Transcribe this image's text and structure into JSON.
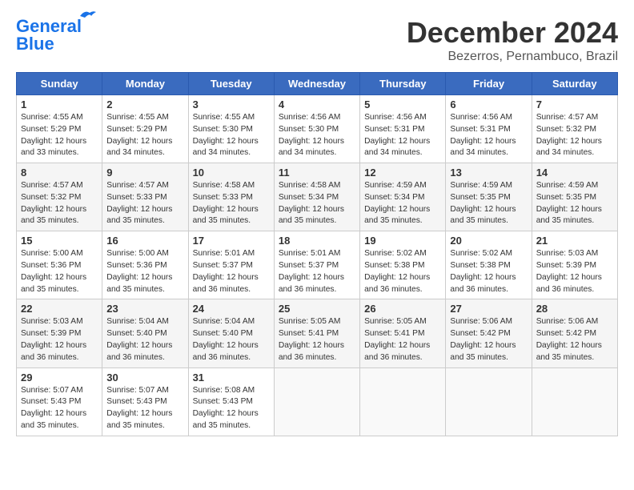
{
  "header": {
    "logo_line1": "General",
    "logo_line2": "Blue",
    "month": "December 2024",
    "location": "Bezerros, Pernambuco, Brazil"
  },
  "weekdays": [
    "Sunday",
    "Monday",
    "Tuesday",
    "Wednesday",
    "Thursday",
    "Friday",
    "Saturday"
  ],
  "weeks": [
    [
      {
        "day": "1",
        "info": "Sunrise: 4:55 AM\nSunset: 5:29 PM\nDaylight: 12 hours\nand 33 minutes."
      },
      {
        "day": "2",
        "info": "Sunrise: 4:55 AM\nSunset: 5:29 PM\nDaylight: 12 hours\nand 34 minutes."
      },
      {
        "day": "3",
        "info": "Sunrise: 4:55 AM\nSunset: 5:30 PM\nDaylight: 12 hours\nand 34 minutes."
      },
      {
        "day": "4",
        "info": "Sunrise: 4:56 AM\nSunset: 5:30 PM\nDaylight: 12 hours\nand 34 minutes."
      },
      {
        "day": "5",
        "info": "Sunrise: 4:56 AM\nSunset: 5:31 PM\nDaylight: 12 hours\nand 34 minutes."
      },
      {
        "day": "6",
        "info": "Sunrise: 4:56 AM\nSunset: 5:31 PM\nDaylight: 12 hours\nand 34 minutes."
      },
      {
        "day": "7",
        "info": "Sunrise: 4:57 AM\nSunset: 5:32 PM\nDaylight: 12 hours\nand 34 minutes."
      }
    ],
    [
      {
        "day": "8",
        "info": "Sunrise: 4:57 AM\nSunset: 5:32 PM\nDaylight: 12 hours\nand 35 minutes."
      },
      {
        "day": "9",
        "info": "Sunrise: 4:57 AM\nSunset: 5:33 PM\nDaylight: 12 hours\nand 35 minutes."
      },
      {
        "day": "10",
        "info": "Sunrise: 4:58 AM\nSunset: 5:33 PM\nDaylight: 12 hours\nand 35 minutes."
      },
      {
        "day": "11",
        "info": "Sunrise: 4:58 AM\nSunset: 5:34 PM\nDaylight: 12 hours\nand 35 minutes."
      },
      {
        "day": "12",
        "info": "Sunrise: 4:59 AM\nSunset: 5:34 PM\nDaylight: 12 hours\nand 35 minutes."
      },
      {
        "day": "13",
        "info": "Sunrise: 4:59 AM\nSunset: 5:35 PM\nDaylight: 12 hours\nand 35 minutes."
      },
      {
        "day": "14",
        "info": "Sunrise: 4:59 AM\nSunset: 5:35 PM\nDaylight: 12 hours\nand 35 minutes."
      }
    ],
    [
      {
        "day": "15",
        "info": "Sunrise: 5:00 AM\nSunset: 5:36 PM\nDaylight: 12 hours\nand 35 minutes."
      },
      {
        "day": "16",
        "info": "Sunrise: 5:00 AM\nSunset: 5:36 PM\nDaylight: 12 hours\nand 35 minutes."
      },
      {
        "day": "17",
        "info": "Sunrise: 5:01 AM\nSunset: 5:37 PM\nDaylight: 12 hours\nand 36 minutes."
      },
      {
        "day": "18",
        "info": "Sunrise: 5:01 AM\nSunset: 5:37 PM\nDaylight: 12 hours\nand 36 minutes."
      },
      {
        "day": "19",
        "info": "Sunrise: 5:02 AM\nSunset: 5:38 PM\nDaylight: 12 hours\nand 36 minutes."
      },
      {
        "day": "20",
        "info": "Sunrise: 5:02 AM\nSunset: 5:38 PM\nDaylight: 12 hours\nand 36 minutes."
      },
      {
        "day": "21",
        "info": "Sunrise: 5:03 AM\nSunset: 5:39 PM\nDaylight: 12 hours\nand 36 minutes."
      }
    ],
    [
      {
        "day": "22",
        "info": "Sunrise: 5:03 AM\nSunset: 5:39 PM\nDaylight: 12 hours\nand 36 minutes."
      },
      {
        "day": "23",
        "info": "Sunrise: 5:04 AM\nSunset: 5:40 PM\nDaylight: 12 hours\nand 36 minutes."
      },
      {
        "day": "24",
        "info": "Sunrise: 5:04 AM\nSunset: 5:40 PM\nDaylight: 12 hours\nand 36 minutes."
      },
      {
        "day": "25",
        "info": "Sunrise: 5:05 AM\nSunset: 5:41 PM\nDaylight: 12 hours\nand 36 minutes."
      },
      {
        "day": "26",
        "info": "Sunrise: 5:05 AM\nSunset: 5:41 PM\nDaylight: 12 hours\nand 36 minutes."
      },
      {
        "day": "27",
        "info": "Sunrise: 5:06 AM\nSunset: 5:42 PM\nDaylight: 12 hours\nand 35 minutes."
      },
      {
        "day": "28",
        "info": "Sunrise: 5:06 AM\nSunset: 5:42 PM\nDaylight: 12 hours\nand 35 minutes."
      }
    ],
    [
      {
        "day": "29",
        "info": "Sunrise: 5:07 AM\nSunset: 5:43 PM\nDaylight: 12 hours\nand 35 minutes."
      },
      {
        "day": "30",
        "info": "Sunrise: 5:07 AM\nSunset: 5:43 PM\nDaylight: 12 hours\nand 35 minutes."
      },
      {
        "day": "31",
        "info": "Sunrise: 5:08 AM\nSunset: 5:43 PM\nDaylight: 12 hours\nand 35 minutes."
      },
      {
        "day": "",
        "info": ""
      },
      {
        "day": "",
        "info": ""
      },
      {
        "day": "",
        "info": ""
      },
      {
        "day": "",
        "info": ""
      }
    ]
  ]
}
